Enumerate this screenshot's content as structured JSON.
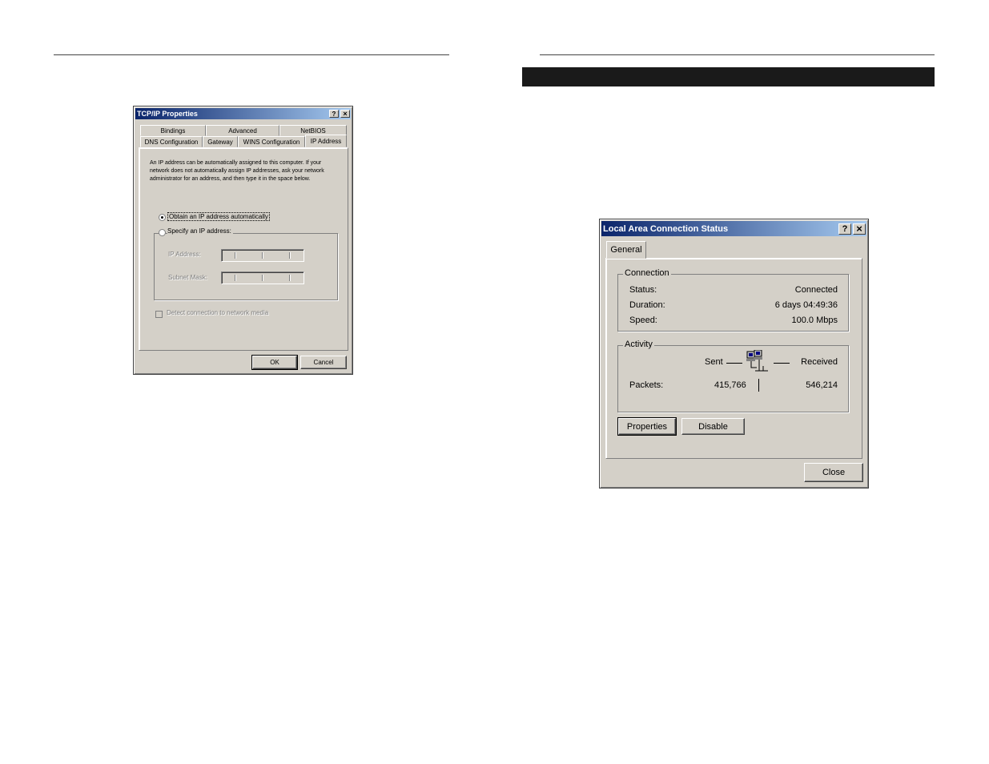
{
  "tcpip": {
    "title": "TCP/IP Properties",
    "help": "?",
    "close": "×",
    "tabs_back": [
      "Bindings",
      "Advanced",
      "NetBIOS"
    ],
    "tabs_front": [
      "DNS Configuration",
      "Gateway",
      "WINS Configuration",
      "IP Address"
    ],
    "description": "An IP address can be automatically assigned to this computer. If your network does not automatically assign IP addresses, ask your network administrator for an address, and then type it in the space below.",
    "radio_auto": "Obtain an IP address automatically",
    "radio_specify": "Specify an IP address:",
    "ip_label": "IP Address:",
    "subnet_label": "Subnet Mask:",
    "detect_label": "Detect connection to network media",
    "ok": "OK",
    "cancel": "Cancel"
  },
  "lac": {
    "title": "Local Area Connection Status",
    "help": "?",
    "close": "×",
    "tab": "General",
    "connection_legend": "Connection",
    "status_label": "Status:",
    "status_value": "Connected",
    "duration_label": "Duration:",
    "duration_value": "6 days 04:49:36",
    "speed_label": "Speed:",
    "speed_value": "100.0 Mbps",
    "activity_legend": "Activity",
    "sent_label": "Sent",
    "received_label": "Received",
    "packets_label": "Packets:",
    "packets_sent": "415,766",
    "packets_received": "546,214",
    "properties_button": "Properties",
    "disable_button": "Disable",
    "close_button": "Close"
  }
}
